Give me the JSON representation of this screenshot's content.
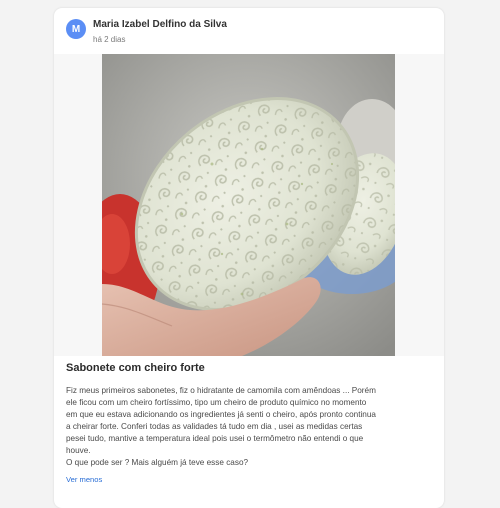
{
  "post": {
    "author_initial": "M",
    "author_name": "Maria Izabel Delfino da Silva",
    "time_ago": "há 2 dias",
    "title": "Sabonete com cheiro forte",
    "body_lines": [
      "Fiz meus primeiros sabonetes, fiz o hidratante de camomila com amêndoas ... Porém",
      "ele ficou com um cheiro fortíssimo, tipo um cheiro de produto químico no momento",
      "em que eu estava adicionando os ingredientes já senti o cheiro, após pronto continua",
      "a cheirar forte. Conferi todas as validades tá tudo em dia , usei as medidas certas",
      "pesei tudo, mantive a temperatura ideal pois usei o termômetro não entendi o que",
      "houve.",
      "O que pode ser ? Mais alguém já teve esse caso?"
    ],
    "see_less_label": "Ver menos"
  },
  "colors": {
    "avatar": "#5b8ef5",
    "link": "#2b6fd6"
  }
}
